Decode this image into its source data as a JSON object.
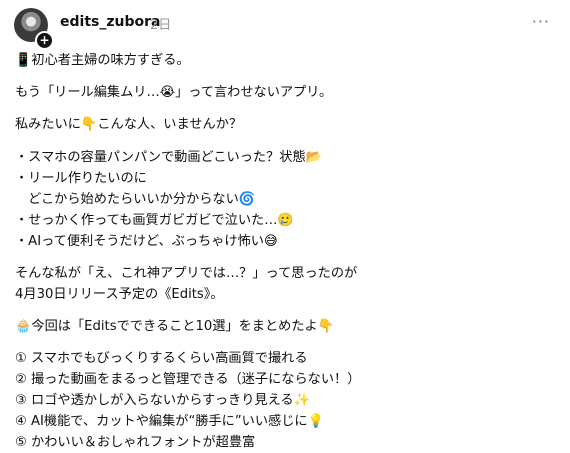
{
  "author": {
    "username": "edits_zubora",
    "time": "2日"
  },
  "lines": [
    "📱初心者主婦の味方すぎる。",
    "もう「リール編集ムリ…😭」って言わせないアプリ。",
    "私みたいに👇こんな人、いませんか？",
    "・スマホの容量パンパンで動画どこいった？状態📂",
    "・リール作りたいのに",
    "　どこから始めたらいいか分からない🌀",
    "・せっかく作っても画質ガビガビで泣いた…🥲",
    "・AIって便利そうだけど、ぶっちゃけ怖い😅",
    "そんな私が「え、これ神アプリでは…？」って思ったのが",
    "4月30日リリース予定の《Edits》。",
    "🧁今回は「Editsでできること10選」をまとめたよ👇",
    "① スマホでもびっくりするくらい高画質で撮れる",
    "② 撮った動画をまるっと管理できる（迷子にならない！）",
    "③ ロゴや透かしが入らないからすっきり見える✨",
    "④ AI機能で、カットや編集が“勝手に”いい感じに💡",
    "⑤ かわいい＆おしゃれフォントが超豊富"
  ]
}
